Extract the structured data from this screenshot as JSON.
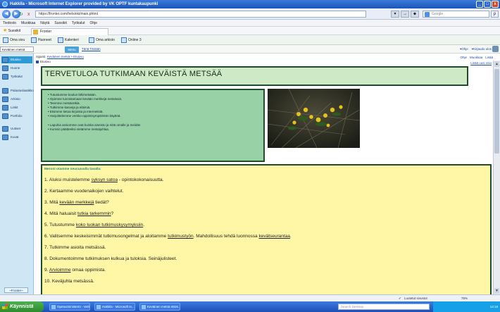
{
  "window": {
    "title": "Hakkila - Microsoft Internet Explorer provided by VK OPTF kuntakaupunki",
    "url": "https://fronter.com/helsinki/main.phtml",
    "live_search_placeholder": "Google",
    "min_label": "_",
    "max_label": "□",
    "close_label": "x",
    "back_label": "◀",
    "forward_label": "▶",
    "stop_label": "x",
    "refresh_label": "↻",
    "go_label": "→",
    "search_go_label": "ρ",
    "tool_label_1": "▾",
    "tool_label_2": "⬥"
  },
  "menu": [
    "Tiedosto",
    "Muokkaa",
    "Näytä",
    "Suosikit",
    "Työkalut",
    "Ohje"
  ],
  "favorites": {
    "label": "Suosikit",
    "star": "★",
    "tab_label": "Fronter"
  },
  "portal_tools": [
    {
      "label": "Oma sivu"
    },
    {
      "label": "Huoneet"
    },
    {
      "label": "Kalenteri"
    },
    {
      "label": "Oma arkisto"
    },
    {
      "label": "Online 3"
    }
  ],
  "portal_nav": {
    "room_select": "Keväinen metsä",
    "go_button": "Menu",
    "link": "Tänä Tänään",
    "right_links": [
      "▾Ohje",
      "▾Kirjaudu ulos"
    ]
  },
  "sidebar": {
    "items": [
      {
        "label": "Etusivu",
        "active": true
      },
      {
        "label": "Huone",
        "active": false
      },
      {
        "label": "Työkalut",
        "active": false
      },
      {
        "label": "Palautuslaatikko",
        "active": false
      },
      {
        "label": "Arkisto",
        "active": false
      },
      {
        "label": "Linkit",
        "active": false
      },
      {
        "label": "Portfolio",
        "active": false
      },
      {
        "label": "Uutiset",
        "active": false
      },
      {
        "label": "Kuvat",
        "active": false
      }
    ],
    "footer": "~Fronter~"
  },
  "breadcrumb": {
    "prefix": "Sijainti:",
    "path": "Keväinen metsä > Etusivu",
    "current": "Etusivu"
  },
  "top_right_links": [
    "Ohje",
    "Muokkaa",
    "Lisää"
  ],
  "new_link": "Lisää uusi osio",
  "content": {
    "title": "TERVETULOA TUTKIMAAN KEVÄISTÄ METSÄÄ",
    "intro_list_1": [
      "Tutustumme koulun lähimetsään.",
      "Opimme tunnistamaan kevään merkkejä metsässä.",
      "Teemme metsäretkiä.",
      "Tutkimme kasveja ja eläimiä.",
      "Etsimme tietoa kirjoista ja Internetistä.",
      "Harjoittelemme verkko-oppimisympäristön käyttöä."
    ],
    "intro_list_2": [
      "Lapuhia ansiomme ovat kuinka aineisto ja mitä omalle ja meidän",
      "Kurssin päätteeksi vietämme metsäjuhlaa."
    ],
    "tasks_heading": "Meroni otamme seuraavalla tavalla:",
    "tasks": [
      {
        "num": "1.",
        "before": "Aluksi muistelemme ",
        "link": "syksyn satoa",
        "after": " - opintokokonaisuutta."
      },
      {
        "num": "2.",
        "before": "Kertaamme vuodenaikojen vaihtelut.",
        "link": "",
        "after": ""
      },
      {
        "num": "3.",
        "before": "Mitä ",
        "link": "kevään merkkejä",
        "after": " tiedät?"
      },
      {
        "num": "4.",
        "before": "Mitä haluaisit ",
        "link": "tutkia tarkemmin",
        "after": "?"
      },
      {
        "num": "5.",
        "before": "Tutustumme ",
        "link": "koko luokan tutkimuskysymyksiin",
        "after": "."
      },
      {
        "num": "6.",
        "before": "Valitsemme keskeisimmät tutkimusongelmat ja aloitamme ",
        "link": "tutkimustyön",
        "after": ". Mahdollisuus tehdä luonnossa ",
        "link2": "kevätseurantaa",
        "after2": "."
      },
      {
        "num": "7.",
        "before": "Tutkimme asioita metsässä.",
        "link": "",
        "after": ""
      },
      {
        "num": "8.",
        "before": "Dokumentoimme tutkimuksen kulkua ja tuloksia. Seinäjulisteet.",
        "link": "",
        "after": ""
      },
      {
        "num": "9.",
        "before": "",
        "link": "Arvioimme",
        "after": " omaa oppimista."
      },
      {
        "num": "10.",
        "before": "Keväjuhla metsässä.",
        "link": "",
        "after": ""
      }
    ]
  },
  "status": {
    "trusted": "Luotetut sivustot",
    "zoom": "75%"
  },
  "taskbar": {
    "start": "Käynnistä",
    "buttons": [
      "Opetusministeriö - Verkk...",
      "Hakkila - Microsoft In...",
      "Keväinen metsä etsim..."
    ],
    "search_placeholder": "Search Desktop",
    "clock": "14:19"
  },
  "scroll": {
    "up": "▲",
    "down": "▼"
  }
}
